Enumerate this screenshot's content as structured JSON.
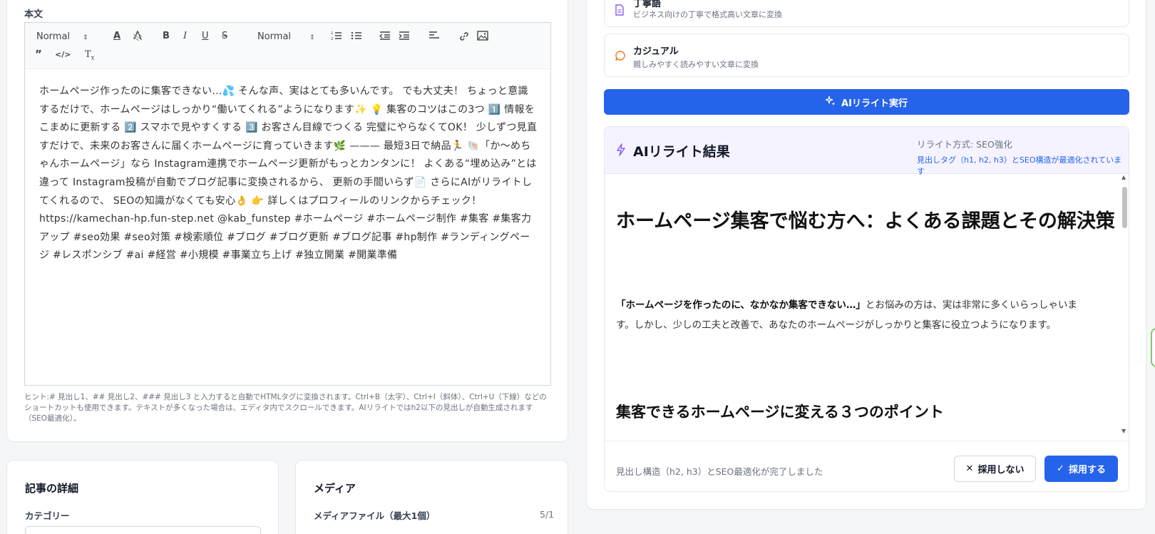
{
  "editor": {
    "label": "本文",
    "toolbar": {
      "header_select": "Normal",
      "size_select": "Normal"
    },
    "content": "ホームページ作ったのに集客できない…💦 そんな声、実はとても多いんです。 でも大丈夫！ ちょっと意識するだけで、ホームページはしっかり“働いてくれる”ようになります✨ 💡 集客のコツはこの3つ 1️⃣ 情報をこまめに更新する 2️⃣ スマホで見やすくする 3️⃣ お客さん目線でつくる 完璧にやらなくてOK！ 少しずつ見直すだけで、未来のお客さんに届くホームページに育っていきます🌿 ——— 最短3日で納品🏃 🐚「か〜めちゃんホームページ」なら Instagram連携でホームページ更新がもっとカンタンに！ よくある“埋め込み”とは違って Instagram投稿が自動でブログ記事に変換されるから、 更新の手間いらず📄 さらにAIがリライトしてくれるので、 SEOの知識がなくても安心👌 👉 詳しくはプロフィールのリンクからチェック！ https://kamechan-hp.fun-step.net @kab_funstep #ホームページ #ホームページ制作 #集客 #集客力アップ #seo効果 #seo対策 #検索順位 #ブログ #ブログ更新 #ブログ記事 #hp制作 #ランディングページ #レスポンシブ #ai #経営 #小規模 #事業立ち上げ #独立開業 #開業準備",
    "hint": "ヒント:# 見出し1、## 見出し2、### 見出し3 と入力すると自動でHTMLタグに変換されます。Ctrl+B（太字）、Ctrl+I（斜体）、Ctrl+U（下線）などのショートカットも使用できます。テキストが多くなった場合は、エディタ内でスクロールできます。AIリライトではh2以下の見出しが自動生成されます（SEO最適化）。"
  },
  "details": {
    "title": "記事の詳細",
    "category_label": "カテゴリー"
  },
  "media": {
    "title": "メディア",
    "file_label": "メディアファイル（最大1個）",
    "count": "5/1"
  },
  "styles": {
    "polite": {
      "title": "丁寧語",
      "desc": "ビジネス向けの丁寧で格式高い文章に変換"
    },
    "casual": {
      "title": "カジュアル",
      "desc": "親しみやすく読みやすい文章に変換"
    }
  },
  "run_button": "AIリライト実行",
  "result": {
    "title": "AIリライト結果",
    "method": "リライト方式: SEO強化",
    "note": "見出しタグ（h1, h2, h3）とSEO構造が最適化されています",
    "h1": "ホームページ集客で悩む方へ：よくある課題とその解決策",
    "para_bold": "「ホームページを作ったのに、なかなか集客できない…」",
    "para_rest": "とお悩みの方は、実は非常に多くいらっしゃいます。しかし、少しの工夫と改善で、あなたのホームページがしっかりと集客に役立つようになります。",
    "h2": "集客できるホームページに変える３つのポイント",
    "status": "見出し構造（h2, h3）とSEO最適化が完了しました",
    "reject": "採用しない",
    "accept": "採用する"
  },
  "colors": {
    "primary": "#2563eb",
    "accent_purple": "#8b5cf6",
    "accent_orange": "#f97316"
  }
}
